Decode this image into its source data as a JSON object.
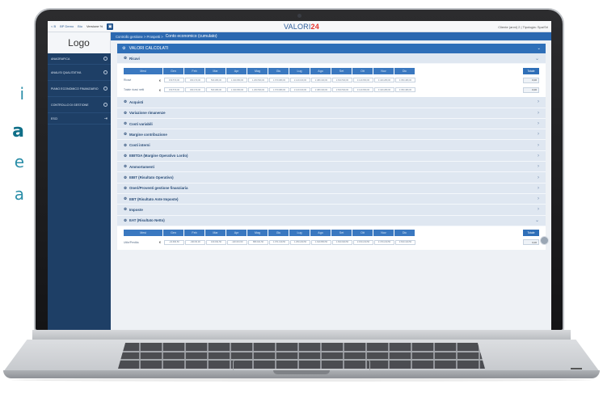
{
  "side_text": [
    "i",
    "a",
    "e",
    "a"
  ],
  "topbar": {
    "nav_items": [
      "< B",
      "BP Demo",
      "Bio"
    ],
    "version_label": "Versione %",
    "brand_left": "VALORI",
    "brand_right": "24",
    "user": "Cliente (anni) 2  |  Tipologia: Spa/Srl"
  },
  "sidebar": {
    "logo": "Logo",
    "items": [
      {
        "label": "ANAGRAFICA",
        "icon": "gear-icon"
      },
      {
        "label": "ANALISI QUALITATIVA",
        "icon": "gear-icon"
      },
      {
        "label": "PIANO ECONOMICO FINANZIARIO",
        "icon": "gear-icon"
      },
      {
        "label": "CONTROLLO DI GESTIONE",
        "icon": "gear-icon"
      },
      {
        "label": "ESCI",
        "icon": "logout-icon"
      }
    ]
  },
  "breadcrumb": {
    "path": "Controllo gestione > Prospetti >",
    "current": "Conto economico (cumulato)"
  },
  "panel": {
    "title": "VALORI CALCOLATI",
    "icon": "gear-icon"
  },
  "ricavi": {
    "title": "Ricavi",
    "header_label": "Mesi",
    "months": [
      "Gen",
      "Feb",
      "Mar",
      "Apr",
      "Mag",
      "Giu",
      "Lug",
      "Ago",
      "Set",
      "Ott",
      "Nov",
      "Dic"
    ],
    "button": "Totale",
    "rows": [
      {
        "label": "Ricavi",
        "currency": "€",
        "values": [
          "150.570,00",
          "300.470,00",
          "500.380,00",
          "1.040.950,00",
          "1.260.560,00",
          "1.670.980,00",
          "2.120.160,00",
          "2.480.340,00",
          "2.810.530,00",
          "3.140.650,00",
          "3.420.280,00",
          "3.350.480,00"
        ],
        "total": "0,00"
      },
      {
        "label": "Totale ricavi netti",
        "currency": "€",
        "values": [
          "150.570,00",
          "300.470,00",
          "500.380,00",
          "1.040.950,00",
          "1.260.560,00",
          "1.670.980,00",
          "2.120.160,00",
          "2.480.340,00",
          "2.810.530,00",
          "3.140.650,00",
          "3.420.280,00",
          "3.350.480,00"
        ],
        "total": "0,00"
      }
    ]
  },
  "sections": [
    "Acquisti",
    "Variazione rimanenze",
    "Costi variabili",
    "Margine contribuzione",
    "Costi interni",
    "EBITDA (Margine Operativo Lordo)",
    "Ammortamenti",
    "EBIT (Risultato Operativo)",
    "Oneri/Proventi gestione finanziaria",
    "EBT (Risultato Ante Imposte)",
    "Imposte"
  ],
  "utile": {
    "title": "EAT (Risultato Netto)",
    "header_label": "Mesi",
    "months": [
      "Gen",
      "Feb",
      "Mar",
      "Apr",
      "Mag",
      "Giu",
      "Lug",
      "Ago",
      "Set",
      "Ott",
      "Nov",
      "Dic"
    ],
    "button": "Totale",
    "row": {
      "label": "Utile/Perdita",
      "currency": "€",
      "values": [
        "-22.690,50",
        "-460.60,00",
        "100.031,50",
        "-120.031,50",
        "880.021,50",
        "1.071.130,50",
        "1.250.240,50",
        "1.640.850,50",
        "1.810.920,50",
        "2.150.210,50",
        "2.470.210,50",
        "2.810.410,50"
      ],
      "total": "0,00"
    }
  },
  "colors": {
    "sidebar": "#1e3f66",
    "accent": "#2f6fb8",
    "brand_red": "#e5342e"
  }
}
